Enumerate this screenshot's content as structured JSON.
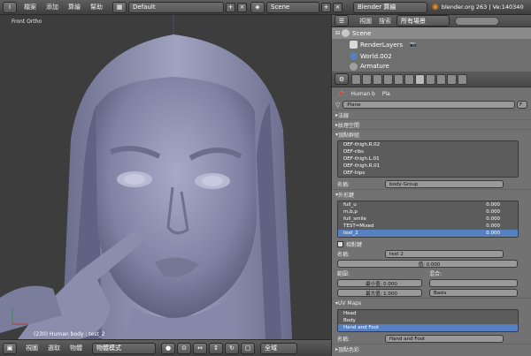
{
  "top": {
    "menu": [
      "檔案",
      "添加",
      "算繪",
      "幫助"
    ],
    "layout": "Default",
    "scene": "Scene",
    "engine": "Blender 算繪",
    "info": "blender.org 263 | Ve:140340"
  },
  "viewport": {
    "label": "Front Ortho",
    "status": "(230) Human body : test_2",
    "bottom_menu": [
      "視圖",
      "選取",
      "物體"
    ],
    "mode": "物體模式",
    "global": "全域"
  },
  "outliner": {
    "menu": [
      "視圖",
      "搜索"
    ],
    "filter": "所有場景",
    "items": [
      "Scene",
      "RenderLayers",
      "World.002",
      "Armature"
    ]
  },
  "props": {
    "crumb_a": "Human b",
    "crumb_b": "Pla",
    "mesh_name": "Plane",
    "F": "F",
    "sections": {
      "normals": "法線",
      "texspace": "紋理空間",
      "vgroups": "頂點群組",
      "shapekeys": "外形鍵",
      "uvmaps": "UV Maps",
      "vcolors": "頂點色彩"
    },
    "vgroups": [
      "DEF-thigh.R.02",
      "DEF-ribs",
      "DEF-thigh.L.01",
      "DEF-thigh.R.01",
      "DEF-hips"
    ],
    "name_label": "名稱:",
    "vgroup_name": "body-Group",
    "shapekeys": [
      {
        "name": "full_u",
        "value": "0.000"
      },
      {
        "name": "m,b,p",
        "value": "0.000"
      },
      {
        "name": "full_smile",
        "value": "0.000"
      },
      {
        "name": "TEST=Mixed",
        "value": "0.000"
      },
      {
        "name": "test_2",
        "value": "0.000"
      }
    ],
    "relative": "相對鍵",
    "shape_name": "test 2",
    "value_label": "值: 0.000",
    "range_label": "範圍:",
    "blend_label": "混合:",
    "min_label": "最小值: 0.000",
    "max_label": "最大值: 1.000",
    "basis": "Basis",
    "uvmaps": [
      "Head",
      "Body",
      "Hand and Foot"
    ],
    "uv_name": "Hand and Foot"
  }
}
